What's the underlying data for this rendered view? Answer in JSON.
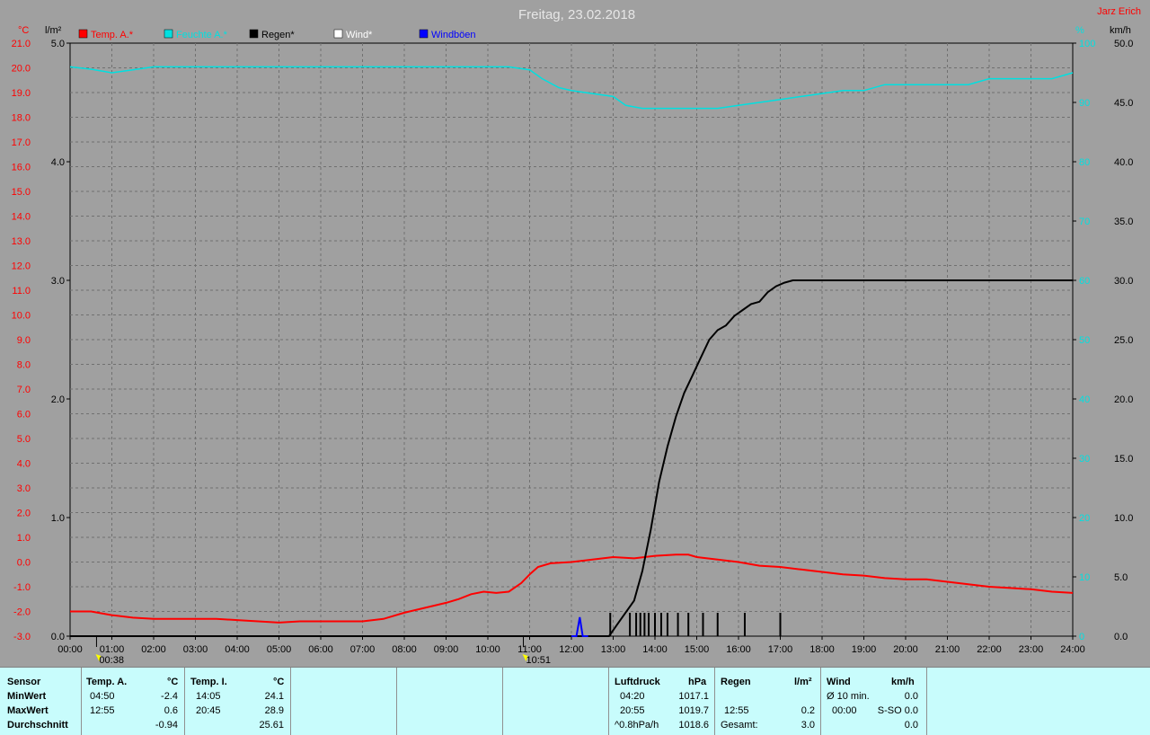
{
  "window": {
    "title": "Freitag, 23.02.2018",
    "author": "Jarz Erich"
  },
  "chart_data": {
    "type": "line",
    "title": "Freitag, 23.02.2018",
    "axes": {
      "temp": {
        "unit": "°C",
        "min": -3,
        "max": 21,
        "step": 1
      },
      "rain": {
        "unit": "l/m²",
        "min": 0,
        "max": 5,
        "step": 1
      },
      "humidity": {
        "unit": "%",
        "min": 0,
        "max": 100,
        "step": 10
      },
      "wind": {
        "unit": "km/h",
        "min": 0,
        "max": 50,
        "step": 5
      },
      "x": {
        "ticks": [
          "00:00",
          "01:00",
          "02:00",
          "03:00",
          "04:00",
          "05:00",
          "06:00",
          "07:00",
          "08:00",
          "09:00",
          "10:00",
          "11:00",
          "12:00",
          "13:00",
          "14:00",
          "15:00",
          "16:00",
          "17:00",
          "18:00",
          "19:00",
          "20:00",
          "21:00",
          "22:00",
          "23:00",
          "24:00"
        ]
      }
    },
    "grid": true,
    "legend_position": "top",
    "sun_markers": [
      {
        "hour": 0.633,
        "label": "00:38"
      },
      {
        "hour": 10.85,
        "label": "10:51"
      }
    ],
    "series": [
      {
        "name": "Temp. A.*",
        "axis": "temp",
        "color": "#ff0000",
        "x": [
          0,
          0.5,
          1,
          1.5,
          2,
          2.5,
          3,
          3.5,
          4,
          4.5,
          5,
          5.5,
          6,
          6.5,
          7,
          7.5,
          8,
          8.5,
          9,
          9.3,
          9.6,
          9.9,
          10.2,
          10.5,
          10.8,
          11.0,
          11.2,
          11.5,
          12,
          12.5,
          13,
          13.5,
          14,
          14.5,
          14.8,
          15,
          15.5,
          16,
          16.5,
          17,
          17.5,
          18,
          18.5,
          19,
          19.5,
          20,
          20.5,
          21,
          21.5,
          22,
          22.5,
          23,
          23.5,
          24
        ],
        "y": [
          -2.0,
          -2.0,
          -2.15,
          -2.25,
          -2.3,
          -2.3,
          -2.3,
          -2.3,
          -2.35,
          -2.4,
          -2.45,
          -2.4,
          -2.4,
          -2.4,
          -2.4,
          -2.3,
          -2.05,
          -1.85,
          -1.65,
          -1.5,
          -1.3,
          -1.2,
          -1.25,
          -1.2,
          -0.85,
          -0.5,
          -0.2,
          -0.05,
          0.0,
          0.1,
          0.2,
          0.15,
          0.25,
          0.3,
          0.3,
          0.2,
          0.1,
          0.0,
          -0.15,
          -0.2,
          -0.3,
          -0.4,
          -0.5,
          -0.55,
          -0.65,
          -0.7,
          -0.7,
          -0.8,
          -0.9,
          -1.0,
          -1.05,
          -1.1,
          -1.2,
          -1.25
        ]
      },
      {
        "name": "Feuchte A.*",
        "axis": "humidity",
        "color": "#00e0e0",
        "x": [
          0,
          0.5,
          1,
          1.5,
          2,
          3,
          4,
          5,
          6,
          7,
          8,
          9,
          10,
          10.5,
          11,
          11.3,
          11.7,
          12,
          12.5,
          13,
          13.3,
          13.7,
          14,
          14.5,
          15,
          15.5,
          16,
          16.5,
          17,
          17.5,
          18,
          18.5,
          19,
          19.5,
          20,
          20.5,
          21,
          21.5,
          22,
          22.5,
          23,
          23.5,
          24
        ],
        "y": [
          96,
          95.6,
          95,
          95.5,
          96,
          96,
          96,
          96,
          96,
          96,
          96,
          96,
          96,
          96,
          95.5,
          94,
          92.5,
          92,
          91.5,
          91,
          89.5,
          89,
          89,
          89,
          89,
          89,
          89.5,
          90,
          90.5,
          91,
          91.5,
          92,
          92,
          93,
          93,
          93,
          93,
          93,
          94,
          94,
          94,
          94,
          95
        ]
      },
      {
        "name": "Regen*",
        "axis": "rain",
        "color": "#000000",
        "x": [
          0,
          12.9,
          13.1,
          13.3,
          13.5,
          13.7,
          13.9,
          14.1,
          14.3,
          14.5,
          14.7,
          14.9,
          15.1,
          15.3,
          15.5,
          15.7,
          15.9,
          16.1,
          16.3,
          16.5,
          16.7,
          16.9,
          17.1,
          17.3,
          17.5,
          18,
          24
        ],
        "y": [
          0,
          0,
          0.1,
          0.2,
          0.3,
          0.55,
          0.9,
          1.3,
          1.6,
          1.85,
          2.05,
          2.2,
          2.35,
          2.5,
          2.58,
          2.62,
          2.7,
          2.75,
          2.8,
          2.82,
          2.9,
          2.95,
          2.98,
          3.0,
          3.0,
          3.0,
          3.0
        ]
      },
      {
        "name": "Wind*",
        "axis": "wind",
        "color": "#ffffff",
        "x": [],
        "y": []
      },
      {
        "name": "Windböen",
        "axis": "wind",
        "color": "#0000ff",
        "x": [
          12,
          12.12,
          12.2,
          12.27,
          12.4
        ],
        "y": [
          0,
          0,
          1.6,
          0,
          0
        ]
      }
    ],
    "rain_bars": [
      12.93,
      13.4,
      13.55,
      13.65,
      13.75,
      13.85,
      14.0,
      14.15,
      14.3,
      14.55,
      14.8,
      15.15,
      15.5,
      16.15,
      17.0
    ]
  },
  "table": {
    "sensor_label": "Sensor",
    "rows": [
      "MinWert",
      "MaxWert",
      "Durchschnitt"
    ],
    "temp_a": {
      "header": "Temp. A.",
      "unit": "°C",
      "times": [
        "04:50",
        "12:55",
        ""
      ],
      "values": [
        "-2.4",
        "0.6",
        "-0.94"
      ]
    },
    "temp_i": {
      "header": "Temp. I.",
      "unit": "°C",
      "times": [
        "14:05",
        "20:45",
        ""
      ],
      "values": [
        "24.1",
        "28.9",
        "25.61"
      ]
    },
    "luftdruck": {
      "header": "Luftdruck",
      "unit": "hPa",
      "times": [
        "04:20",
        "20:55",
        "^0.8hPa/h"
      ],
      "values": [
        "1017.1",
        "1019.7",
        "1018.6"
      ]
    },
    "regen": {
      "header": "Regen",
      "unit": "l/m²",
      "times": [
        "",
        "12:55",
        "Gesamt:"
      ],
      "values": [
        "",
        "0.2",
        "3.0"
      ]
    },
    "wind": {
      "header": "Wind",
      "unit": "km/h",
      "times": [
        "Ø 10 min.",
        "00:00",
        ""
      ],
      "values": [
        "0.0",
        "S-SO 0.0",
        "0.0"
      ]
    }
  }
}
